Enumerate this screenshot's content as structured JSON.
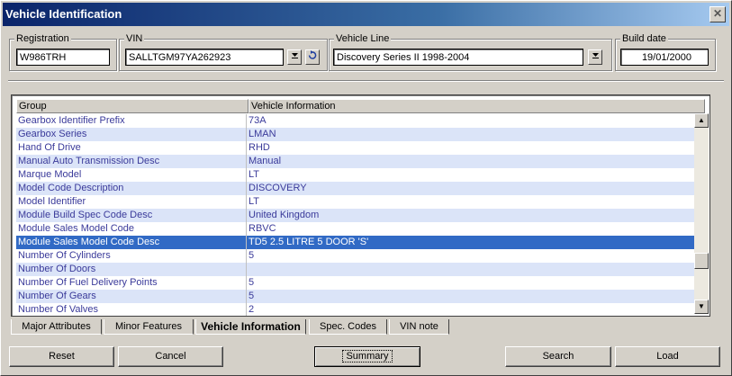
{
  "window": {
    "title": "Vehicle Identification",
    "close_icon": "close-icon"
  },
  "fields": {
    "registration": {
      "label": "Registration",
      "value": "W986TRH"
    },
    "vin": {
      "label": "VIN",
      "value": "SALLTGM97YA262923"
    },
    "vehicle_line": {
      "label": "Vehicle Line",
      "value": "Discovery Series II 1998-2004"
    },
    "build_date": {
      "label": "Build date",
      "value": "19/01/2000"
    }
  },
  "grid": {
    "headers": [
      "Group",
      "Vehicle Information"
    ],
    "rows": [
      {
        "group": "Gearbox Identifier Prefix",
        "info": "73A"
      },
      {
        "group": "Gearbox Series",
        "info": "LMAN"
      },
      {
        "group": "Hand Of Drive",
        "info": "RHD"
      },
      {
        "group": "Manual Auto Transmission Desc",
        "info": "Manual"
      },
      {
        "group": "Marque Model",
        "info": "LT"
      },
      {
        "group": "Model Code Description",
        "info": "DISCOVERY"
      },
      {
        "group": "Model Identifier",
        "info": "LT"
      },
      {
        "group": "Module Build Spec Code Desc",
        "info": "United Kingdom"
      },
      {
        "group": "Module Sales Model Code",
        "info": "RBVC"
      },
      {
        "group": "Module Sales Model Code Desc",
        "info": "TD5 2.5 LITRE 5 DOOR 'S'"
      },
      {
        "group": "Number Of Cylinders",
        "info": "5"
      },
      {
        "group": "Number Of Doors",
        "info": ""
      },
      {
        "group": "Number Of Fuel Delivery Points",
        "info": "5"
      },
      {
        "group": "Number Of Gears",
        "info": "5"
      },
      {
        "group": "Number Of Valves",
        "info": "2"
      }
    ],
    "selected_index": 9
  },
  "tabs": [
    "Major Attributes",
    "Minor Features",
    "Vehicle Information",
    "Spec. Codes",
    "VIN note"
  ],
  "active_tab": "Vehicle Information",
  "buttons": {
    "reset": "Reset",
    "cancel": "Cancel",
    "summary": "Summary",
    "search": "Search",
    "load": "Load"
  },
  "colors": {
    "title_start": "#0a246a",
    "selection": "#316ac5",
    "alt_row": "#dbe4f8",
    "text_link": "#3a3a9a"
  }
}
